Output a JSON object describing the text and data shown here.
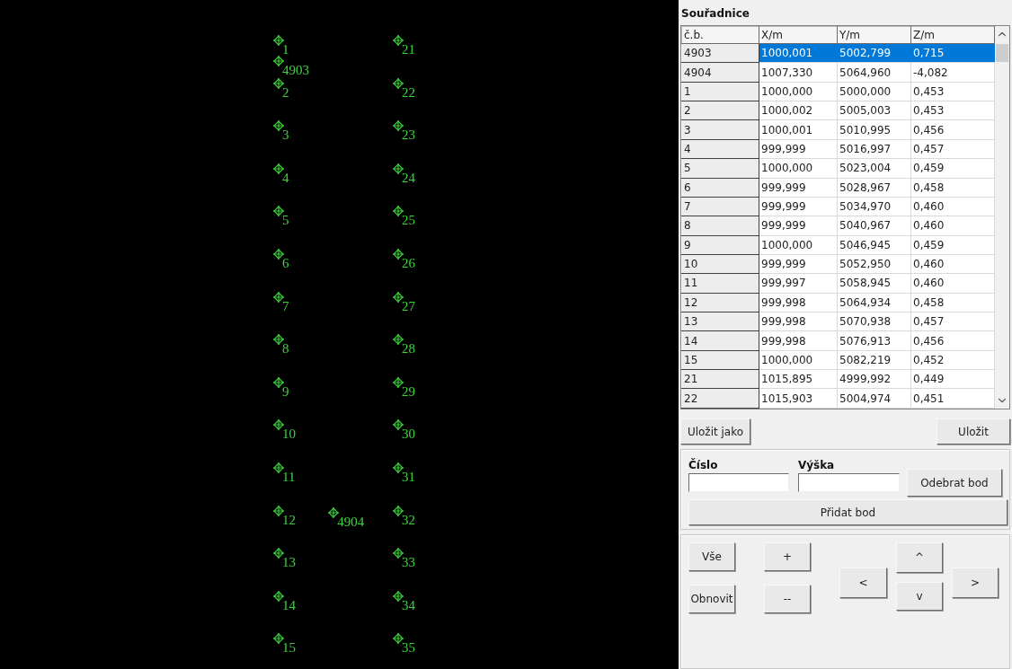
{
  "canvas": {
    "left_column": [
      "1",
      "2",
      "3",
      "4",
      "5",
      "6",
      "7",
      "8",
      "9",
      "10",
      "11",
      "12",
      "13",
      "14",
      "15"
    ],
    "right_column": [
      "21",
      "22",
      "23",
      "24",
      "25",
      "26",
      "27",
      "28",
      "29",
      "30",
      "31",
      "32",
      "33",
      "34",
      "35"
    ],
    "extra_points": [
      {
        "label": "4903"
      },
      {
        "label": "4904"
      }
    ]
  },
  "panel": {
    "title": "Souřadnice",
    "table": {
      "columns": [
        "č.b.",
        "X/m",
        "Y/m",
        "Z/m"
      ],
      "rows": [
        {
          "cells": [
            "4903",
            "1000,001",
            "5002,799",
            "0,715"
          ],
          "selected": true
        },
        {
          "cells": [
            "4904",
            "1007,330",
            "5064,960",
            "-4,082"
          ],
          "selected": false
        },
        {
          "cells": [
            "1",
            "1000,000",
            "5000,000",
            "0,453"
          ],
          "selected": false
        },
        {
          "cells": [
            "2",
            "1000,002",
            "5005,003",
            "0,453"
          ],
          "selected": false
        },
        {
          "cells": [
            "3",
            "1000,001",
            "5010,995",
            "0,456"
          ],
          "selected": false
        },
        {
          "cells": [
            "4",
            "999,999",
            "5016,997",
            "0,457"
          ],
          "selected": false
        },
        {
          "cells": [
            "5",
            "1000,000",
            "5023,004",
            "0,459"
          ],
          "selected": false
        },
        {
          "cells": [
            "6",
            "999,999",
            "5028,967",
            "0,458"
          ],
          "selected": false
        },
        {
          "cells": [
            "7",
            "999,999",
            "5034,970",
            "0,460"
          ],
          "selected": false
        },
        {
          "cells": [
            "8",
            "999,999",
            "5040,967",
            "0,460"
          ],
          "selected": false
        },
        {
          "cells": [
            "9",
            "1000,000",
            "5046,945",
            "0,459"
          ],
          "selected": false
        },
        {
          "cells": [
            "10",
            "999,999",
            "5052,950",
            "0,460"
          ],
          "selected": false
        },
        {
          "cells": [
            "11",
            "999,997",
            "5058,945",
            "0,460"
          ],
          "selected": false
        },
        {
          "cells": [
            "12",
            "999,998",
            "5064,934",
            "0,458"
          ],
          "selected": false
        },
        {
          "cells": [
            "13",
            "999,998",
            "5070,938",
            "0,457"
          ],
          "selected": false
        },
        {
          "cells": [
            "14",
            "999,998",
            "5076,913",
            "0,456"
          ],
          "selected": false
        },
        {
          "cells": [
            "15",
            "1000,000",
            "5082,219",
            "0,452"
          ],
          "selected": false
        },
        {
          "cells": [
            "21",
            "1015,895",
            "4999,992",
            "0,449"
          ],
          "selected": false
        },
        {
          "cells": [
            "22",
            "1015,903",
            "5004,974",
            "0,451"
          ],
          "selected": false
        }
      ]
    },
    "save_as_button": "Uložit jako",
    "save_button": "Uložit",
    "point_form": {
      "number_label": "Číslo",
      "height_label": "Výška",
      "remove_button": "Odebrat bod",
      "add_button": "Přidat bod"
    },
    "nav": {
      "all_button": "Vše",
      "refresh_button": "Obnovit",
      "zoom_in_button": "+",
      "zoom_out_button": "--",
      "left_button": "<",
      "up_button": "^",
      "down_button": "v",
      "right_button": ">"
    }
  }
}
